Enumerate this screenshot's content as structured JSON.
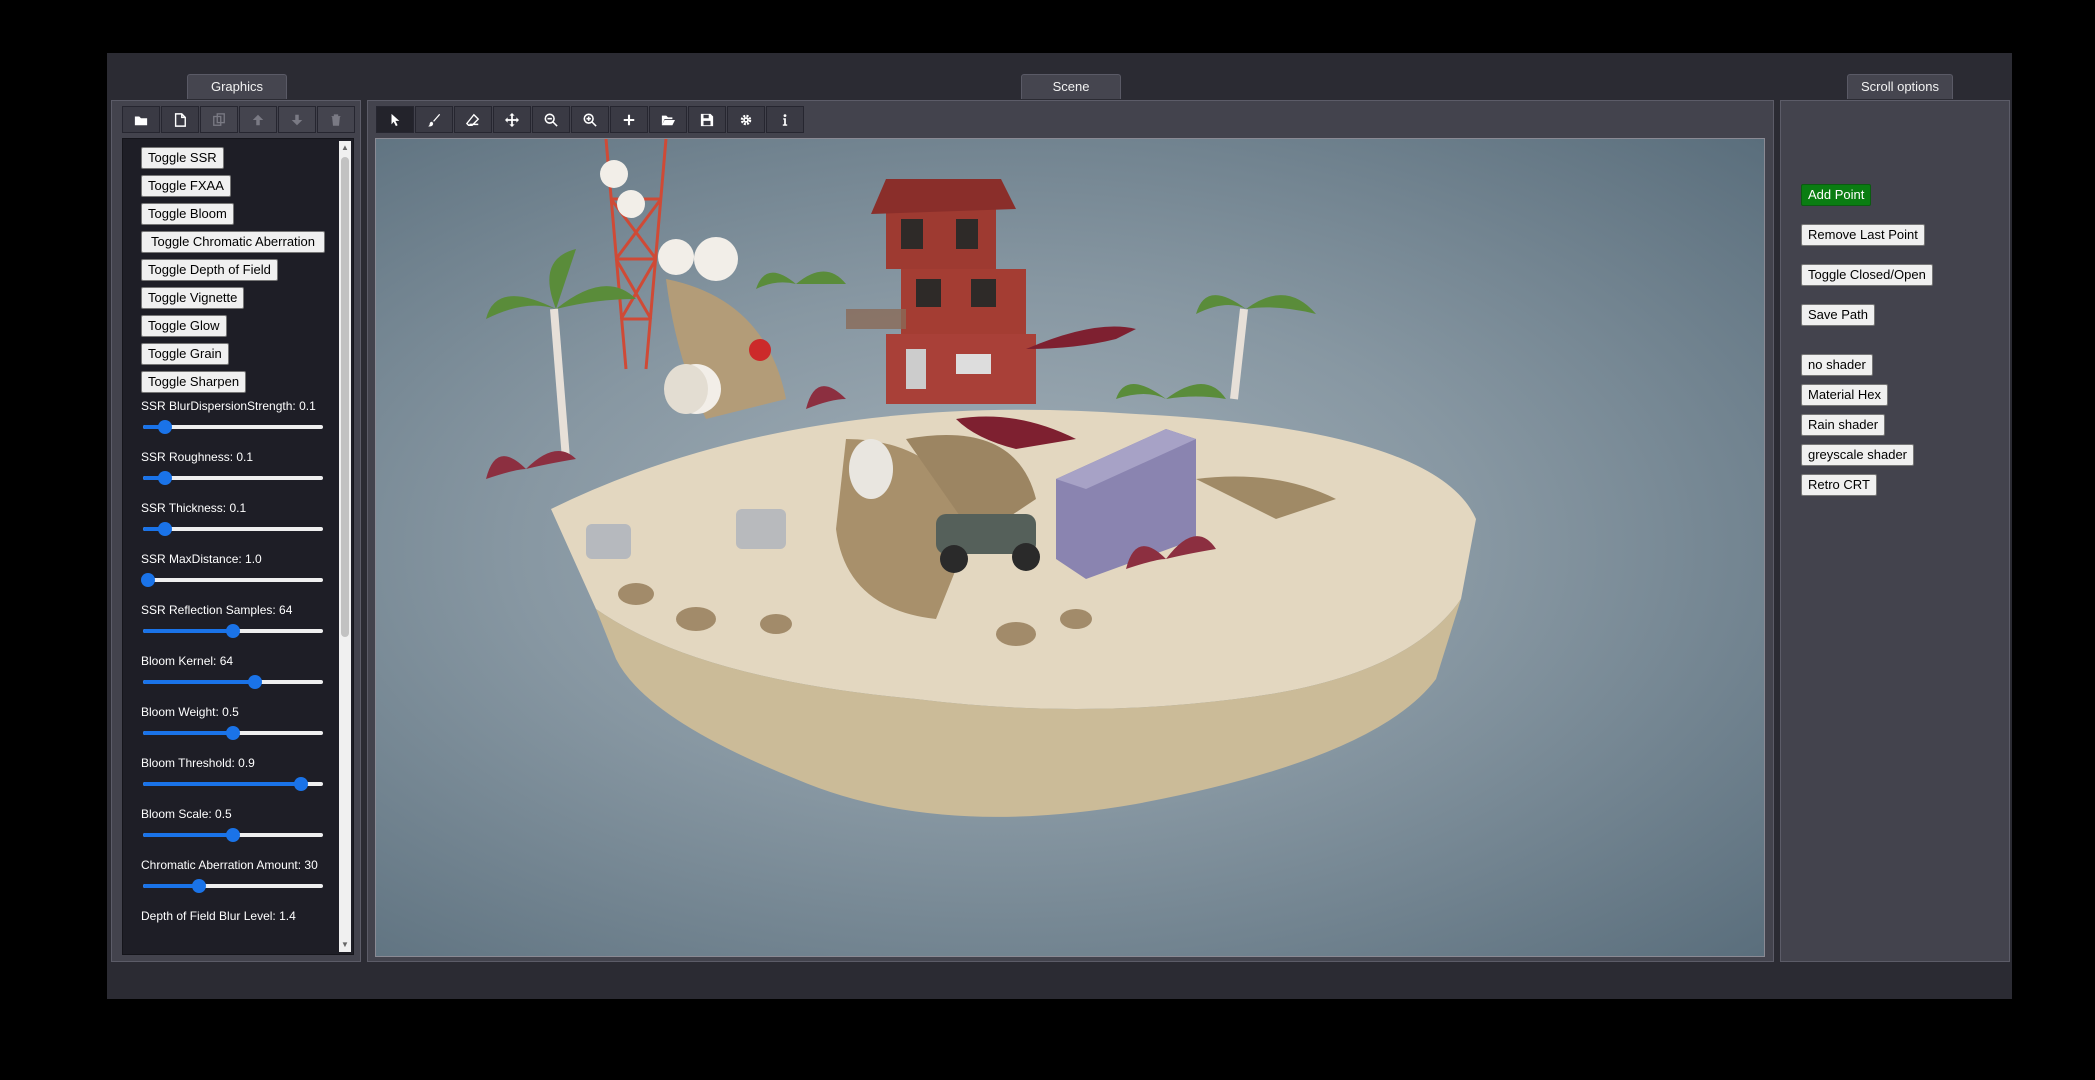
{
  "tabs": {
    "graphics": "Graphics",
    "scene": "Scene",
    "scroll_options": "Scroll options"
  },
  "left_toolbar": [
    {
      "icon": "folder-icon",
      "state": "enabled"
    },
    {
      "icon": "new-file-icon",
      "state": "enabled"
    },
    {
      "icon": "copy-icon",
      "state": "disabled"
    },
    {
      "icon": "arrow-up-icon",
      "state": "disabled"
    },
    {
      "icon": "arrow-down-icon",
      "state": "disabled"
    },
    {
      "icon": "trash-icon",
      "state": "disabled"
    }
  ],
  "center_toolbar": [
    {
      "icon": "pointer-icon",
      "state": "active"
    },
    {
      "icon": "brush-icon",
      "state": "enabled"
    },
    {
      "icon": "eraser-icon",
      "state": "enabled"
    },
    {
      "icon": "move-icon",
      "state": "enabled"
    },
    {
      "icon": "zoom-out-icon",
      "state": "enabled"
    },
    {
      "icon": "zoom-in-icon",
      "state": "enabled"
    },
    {
      "icon": "plus-icon",
      "state": "enabled"
    },
    {
      "icon": "folder-open-icon",
      "state": "enabled"
    },
    {
      "icon": "save-icon",
      "state": "enabled"
    },
    {
      "icon": "gear-icon",
      "state": "enabled"
    },
    {
      "icon": "info-icon",
      "state": "enabled"
    }
  ],
  "graphics": {
    "toggles": [
      "Toggle SSR",
      "Toggle FXAA",
      "Toggle Bloom",
      "Toggle Chromatic Aberration",
      "Toggle Depth of Field",
      "Toggle Vignette",
      "Toggle Glow",
      "Toggle Grain",
      "Toggle Sharpen"
    ],
    "sliders": [
      {
        "label": "SSR BlurDispersionStrength: 0.1",
        "fraction": 0.1
      },
      {
        "label": "SSR Roughness: 0.1",
        "fraction": 0.1
      },
      {
        "label": "SSR Thickness: 0.1",
        "fraction": 0.1
      },
      {
        "label": "SSR MaxDistance: 1.0",
        "fraction": 0.0
      },
      {
        "label": "SSR Reflection Samples: 64",
        "fraction": 0.5
      },
      {
        "label": "Bloom Kernel: 64",
        "fraction": 0.63
      },
      {
        "label": "Bloom Weight: 0.5",
        "fraction": 0.5
      },
      {
        "label": "Bloom Threshold: 0.9",
        "fraction": 0.9
      },
      {
        "label": "Bloom Scale: 0.5",
        "fraction": 0.5
      },
      {
        "label": "Chromatic Aberration Amount: 30",
        "fraction": 0.3
      }
    ],
    "trailing_label": "Depth of Field Blur Level: 1.4"
  },
  "scroll_options": {
    "add_point": "Add Point",
    "remove_last_point": "Remove Last Point",
    "toggle_closed_open": "Toggle Closed/Open",
    "save_path": "Save Path",
    "shaders": [
      "no shader",
      "Material Hex",
      "Rain shader",
      "greyscale shader",
      "Retro CRT"
    ]
  },
  "colors": {
    "accent_blue": "#1a73e8",
    "add_point_green": "#0a7d12",
    "panel": "#43434d",
    "background": "#2b2b33"
  }
}
